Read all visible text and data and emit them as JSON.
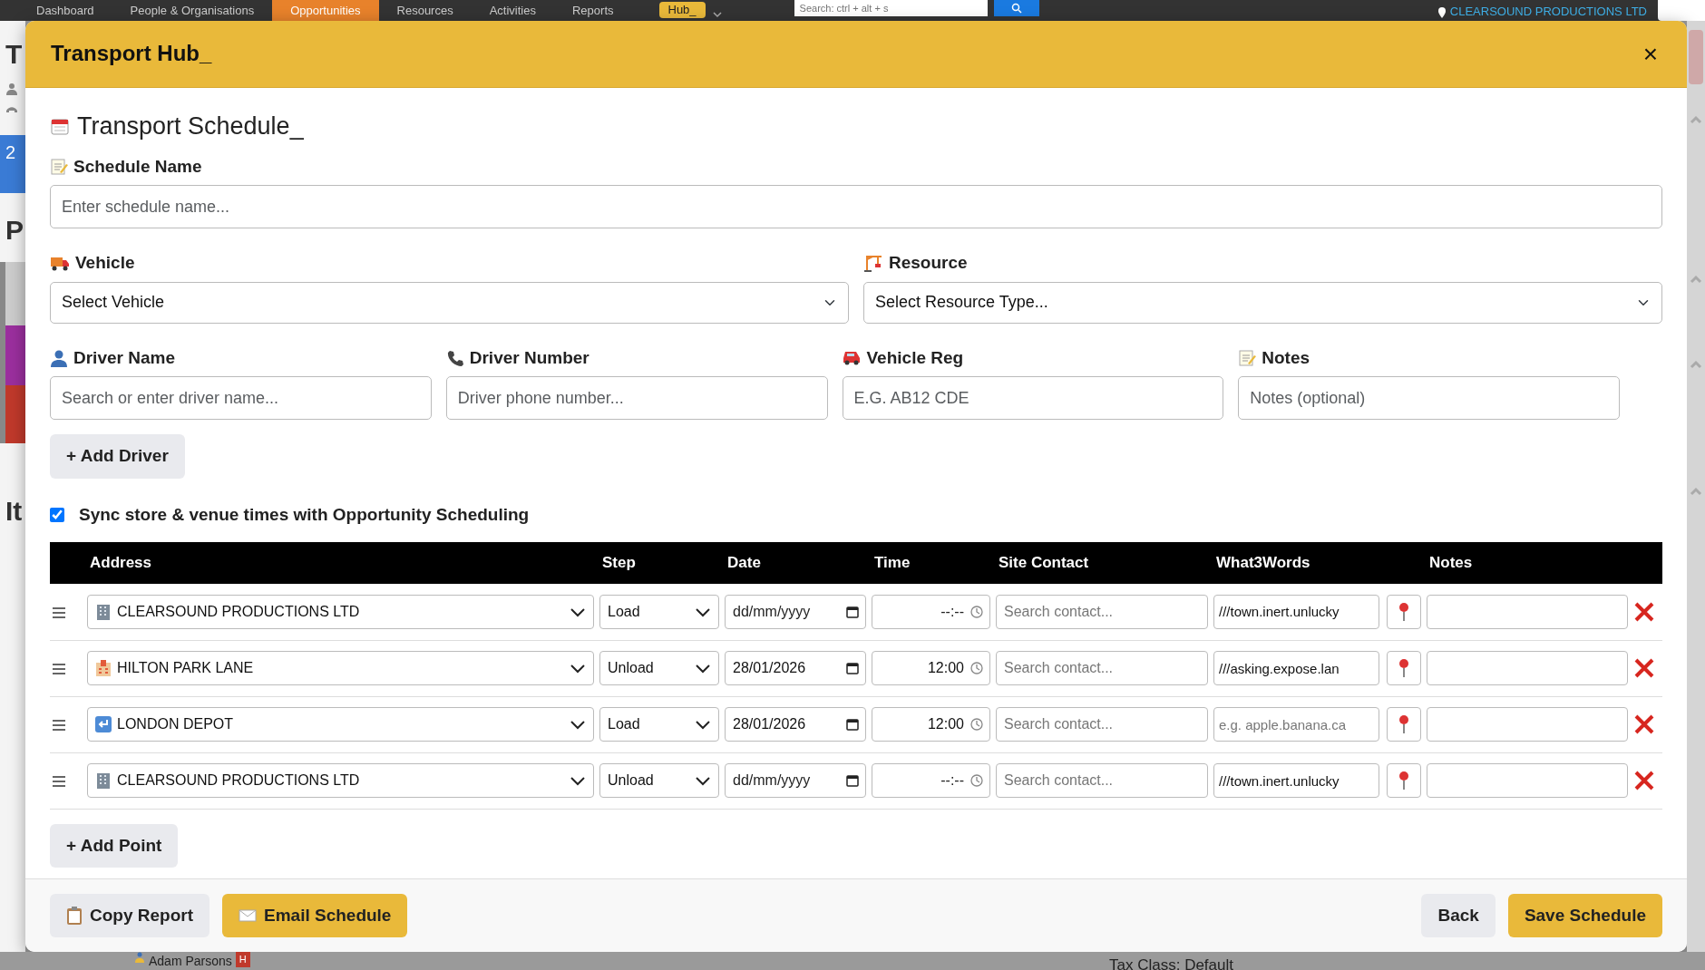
{
  "topbar": {
    "nav_items": [
      {
        "label": "Dashboard",
        "selected": false
      },
      {
        "label": "People & Organisations",
        "selected": false
      },
      {
        "label": "Opportunities",
        "selected": true
      },
      {
        "label": "Resources",
        "selected": false
      },
      {
        "label": "Activities",
        "selected": false
      },
      {
        "label": "Reports",
        "selected": false
      }
    ],
    "hub_button": "Hub_",
    "search": {
      "placeholder": "Search: ctrl + alt + s"
    },
    "company": "CLEARSOUND PRODUCTIONS LTD"
  },
  "background": {
    "fragments": [
      "T",
      "2",
      "P",
      "It"
    ],
    "person": "Adam Parsons",
    "person_badge": "H",
    "tax_class": "Tax Class: Default"
  },
  "modal": {
    "title": "Transport Hub_",
    "close": "×",
    "schedule_title": "Transport Schedule_",
    "schedule_name": {
      "label": "Schedule Name",
      "placeholder": "Enter schedule name..."
    },
    "vehicle": {
      "label": "Vehicle",
      "value": "Select Vehicle"
    },
    "resource": {
      "label": "Resource",
      "value": "Select Resource Type..."
    },
    "driver_fields": [
      {
        "kind": "driver",
        "label": "Driver Name",
        "placeholder": "Search or enter driver name..."
      },
      {
        "kind": "phone",
        "label": "Driver Number",
        "placeholder": "Driver phone number..."
      },
      {
        "kind": "reg",
        "label": "Vehicle Reg",
        "placeholder": "E.G. AB12 CDE"
      },
      {
        "kind": "notes",
        "label": "Notes",
        "placeholder": "Notes (optional)"
      }
    ],
    "add_driver": "+ Add Driver",
    "sync": {
      "label": "Sync store & venue times with Opportunity Scheduling",
      "checked": true
    },
    "table": {
      "columns": [
        "Address",
        "Step",
        "Date",
        "Time",
        "Site Contact",
        "What3Words",
        "Notes"
      ],
      "rows": [
        {
          "kind": "building",
          "address": "CLEARSOUND PRODUCTIONS LTD",
          "step": "Load",
          "date": {
            "placeholder": "dd/mm/yyyy"
          },
          "time": {
            "placeholder": "--:--"
          },
          "contact": {
            "placeholder": "Search contact..."
          },
          "w3w": {
            "value": "///town.inert.unlucky"
          }
        },
        {
          "kind": "hotel",
          "address": "HILTON PARK LANE",
          "step": "Unload",
          "date": {
            "value": "28/01/2026"
          },
          "time": {
            "value": "12:00"
          },
          "contact": {
            "placeholder": "Search contact..."
          },
          "w3w": {
            "value": "///asking.expose.lan"
          }
        },
        {
          "kind": "return",
          "address": "LONDON DEPOT",
          "step": "Load",
          "date": {
            "value": "28/01/2026"
          },
          "time": {
            "value": "12:00"
          },
          "contact": {
            "placeholder": "Search contact..."
          },
          "w3w": {
            "placeholder": "e.g. apple.banana.ca"
          }
        },
        {
          "kind": "building",
          "address": "CLEARSOUND PRODUCTIONS LTD",
          "step": "Unload",
          "date": {
            "placeholder": "dd/mm/yyyy"
          },
          "time": {
            "placeholder": "--:--"
          },
          "contact": {
            "placeholder": "Search contact..."
          },
          "w3w": {
            "value": "///town.inert.unlucky"
          }
        }
      ]
    },
    "add_point": "+ Add Point",
    "footer": {
      "copy": "Copy Report",
      "email": "Email Schedule",
      "back": "Back",
      "save": "Save Schedule"
    }
  }
}
